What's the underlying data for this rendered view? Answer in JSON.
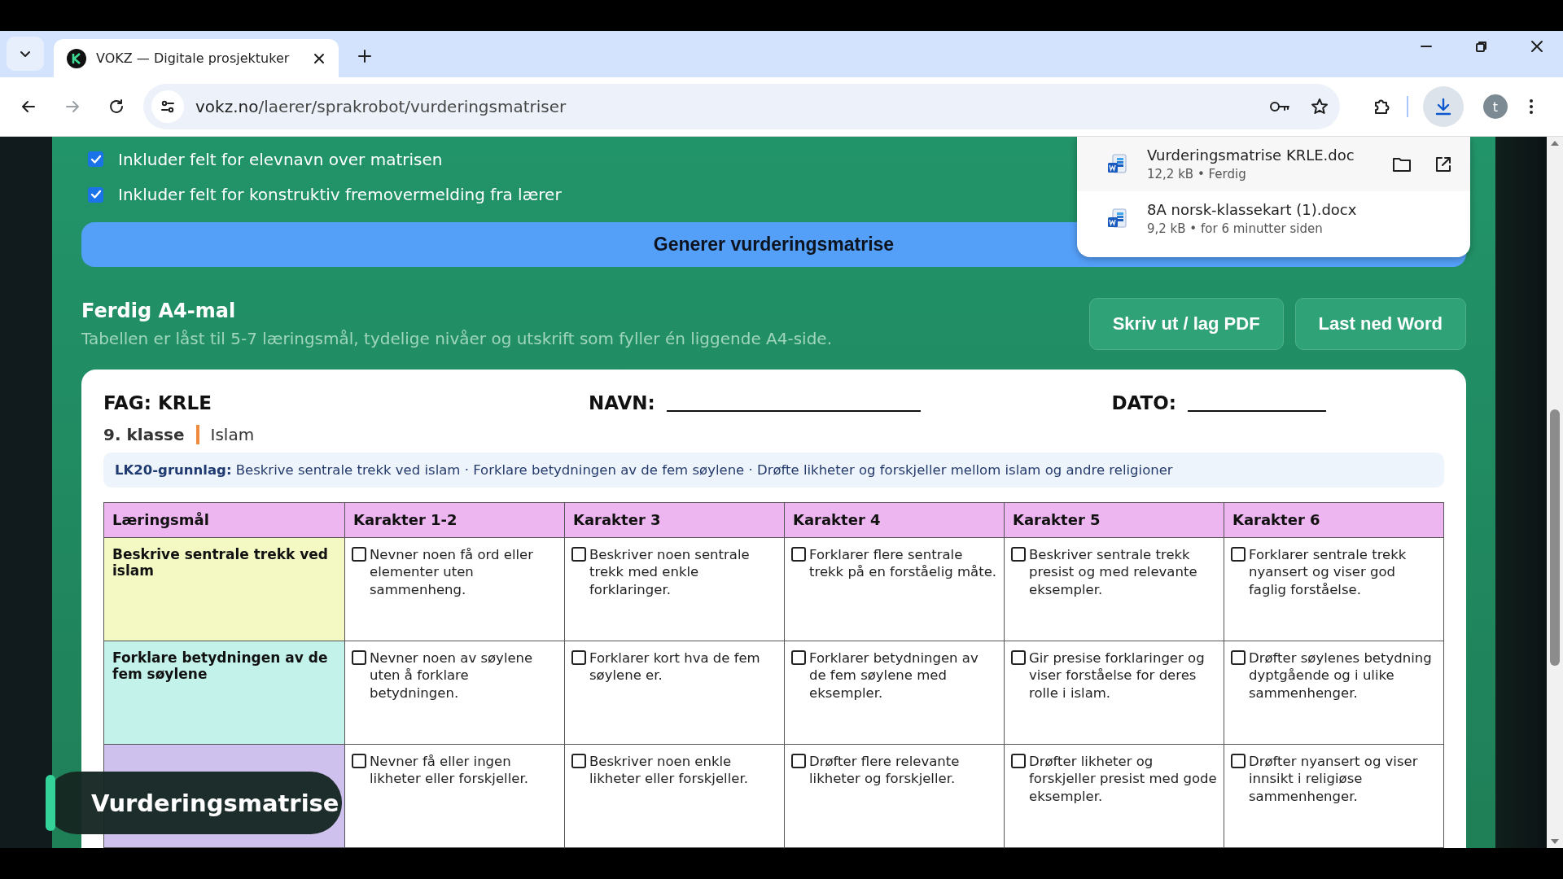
{
  "browser": {
    "tab": {
      "title": "VOKZ — Digitale prosjektuker",
      "selected": true
    },
    "url": {
      "host": "vokz.no",
      "path": "/laerer/sprakrobot/vurderingsmatriser"
    },
    "profile_initial": "t"
  },
  "downloads": [
    {
      "name": "Vurderingsmatrise KRLE.doc",
      "meta": "12,2 kB • Ferdig",
      "actions": true
    },
    {
      "name": "8A norsk-klassekart (1).docx",
      "meta": "9,2 kB • for 6 minutter siden",
      "actions": false
    }
  ],
  "options": [
    {
      "label": "Inkluder felt for elevnavn over matrisen",
      "checked": true
    },
    {
      "label": "Inkluder felt for konstruktiv fremovermelding fra lærer",
      "checked": true
    }
  ],
  "generate_button": "Generer vurderingsmatrise",
  "template": {
    "title": "Ferdig A4-mal",
    "subtitle": "Tabellen er låst til 5-7 læringsmål, tydelige nivåer og utskrift som fyller én liggende A4-side.",
    "buttons": [
      "Skriv ut / lag PDF",
      "Last ned Word"
    ]
  },
  "sheet": {
    "subject": "FAG: KRLE",
    "name_label": "NAVN:",
    "date_label": "DATO:",
    "grade": "9. klasse",
    "topic": "Islam",
    "basis": "**LK20-grunnlag:** Beskrive sentrale trekk ved islam · Forklare betydningen av de fem søylene · Drøfte likheter og forskjeller mellom islam og andre religioner",
    "columns": [
      "Læringsmål",
      "Karakter 1-2",
      "Karakter 3",
      "Karakter 4",
      "Karakter 5",
      "Karakter 6"
    ],
    "rows": [
      {
        "color": "#f4f9c4",
        "cells": [
          {
            "kind": "goal",
            "text": "Beskrive sentrale trekk ved islam"
          },
          {
            "text": "Nevner noen få ord eller elementer uten sammenheng.",
            "checked": false
          },
          {
            "text": "Beskriver noen sentrale trekk med enkle forklaringer.",
            "checked": false
          },
          {
            "text": "Forklarer flere sentrale trekk på en forståelig måte.",
            "checked": false
          },
          {
            "text": "Beskriver sentrale trekk presist og med relevante eksempler.",
            "checked": false
          },
          {
            "text": "Forklarer sentrale trekk nyansert og viser god faglig forståelse.",
            "checked": false
          }
        ]
      },
      {
        "color": "#c3f2ea",
        "cells": [
          {
            "kind": "goal",
            "text": "Forklare betydningen av de fem søylene"
          },
          {
            "text": "Nevner noen av søylene uten å forklare betydningen.",
            "checked": false
          },
          {
            "text": "Forklarer kort hva de fem søylene er.",
            "checked": false
          },
          {
            "text": "Forklarer betydningen av de fem søylene med eksempler.",
            "checked": false
          },
          {
            "text": "Gir presise forklaringer og viser forståelse for deres rolle i islam.",
            "checked": false
          },
          {
            "text": "Drøfter søylenes betydning dyptgående og i ulike sammenhenger.",
            "checked": false
          }
        ]
      },
      {
        "color": "#cfc1ee",
        "cells": [
          {
            "kind": "goal",
            "text": ""
          },
          {
            "text": "Nevner få eller ingen likheter eller forskjeller.",
            "checked": false
          },
          {
            "text": "Beskriver noen enkle likheter eller forskjeller.",
            "checked": false
          },
          {
            "text": "Drøfter flere relevante likheter og forskjeller.",
            "checked": false
          },
          {
            "text": "Drøfter likheter og forskjeller presist med gode eksempler.",
            "checked": false
          },
          {
            "text": "Drøfter nyansert og viser innsikt i religiøse sammenhenger.",
            "checked": false
          }
        ]
      }
    ]
  },
  "caption": "Vurderingsmatrise"
}
